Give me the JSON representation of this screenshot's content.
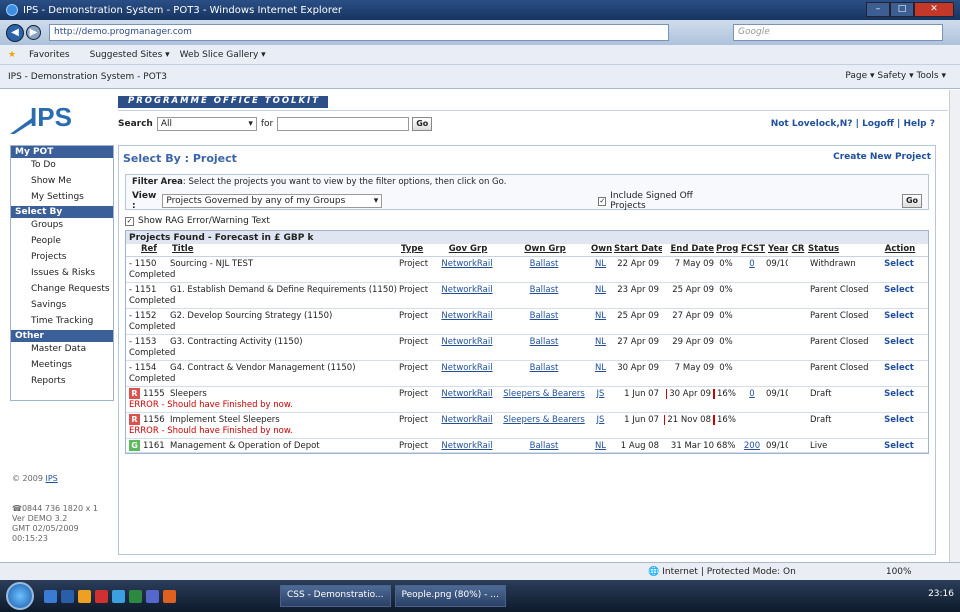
{
  "window": {
    "title": "IPS - Demonstration System - POT3 - Windows Internet Explorer"
  },
  "address": {
    "url": "http://demo.progmanager.com",
    "search_placeholder": "Google"
  },
  "favorites": {
    "label": "Favorites",
    "suggested": "Suggested Sites ▾",
    "webslice": "Web Slice Gallery ▾"
  },
  "tab": {
    "title": "IPS - Demonstration System - POT3",
    "tools": "Page ▾  Safety ▾  Tools ▾"
  },
  "app": {
    "brand": "IPS",
    "banner": "PROGRAMME OFFICE TOOLKIT",
    "search_label": "Search",
    "search_scope": "All",
    "for_label": "for",
    "go": "Go",
    "user_links": "Not Lovelock,N? | Logoff | Help"
  },
  "sidebar": {
    "sections": [
      {
        "title": "My POT",
        "items": [
          "To Do",
          "Show Me",
          "My Settings"
        ]
      },
      {
        "title": "Select By",
        "items": [
          "Groups",
          "People",
          "Projects",
          "Issues & Risks",
          "Change Requests",
          "Savings",
          "Time Tracking"
        ]
      },
      {
        "title": "Other",
        "items": [
          "Master Data",
          "Meetings",
          "Reports"
        ]
      }
    ],
    "copyright": "© 2009",
    "copyright_link": "IPS",
    "phone": "0844 736 1820 x 1",
    "version": "Ver DEMO 3.2",
    "gmt": "GMT 02/05/2009",
    "time": "00:15:23"
  },
  "main": {
    "title": "Select By : Project",
    "create_link": "Create New Project",
    "filter_label": "Filter Area",
    "filter_help": ": Select the projects you want to view by the filter options, then click on Go.",
    "view_label": "View :",
    "view_value": "Projects Governed by any of my Groups",
    "include_label": "Include Signed Off Projects",
    "rag_label": "Show RAG Error/Warning Text",
    "found_title": "Projects Found - Forecast in £ GBP k",
    "columns": [
      "Ref",
      "Title",
      "Type",
      "Gov Grp",
      "Own Grp",
      "Own",
      "Start Date",
      "End Date",
      "Prog",
      "FCST",
      "Year",
      "CR",
      "Status",
      "Action"
    ],
    "rows": [
      {
        "rag": "",
        "ref": "- 1150",
        "title": "Sourcing - NJL TEST",
        "type": "Project",
        "gov": "NetworkRail",
        "own_grp": "Ballast",
        "own": "NL",
        "start": "22 Apr 09",
        "end": "7 May 09",
        "prog": "0%",
        "fcst": "0",
        "year": "09/10",
        "cr": "",
        "status": "Withdrawn",
        "action": "Select",
        "sub": "Completed",
        "sub_err": false,
        "flag": false
      },
      {
        "rag": "",
        "ref": "- 1151",
        "title": "G1. Establish Demand & Define Requirements (1150)",
        "type": "Project",
        "gov": "NetworkRail",
        "own_grp": "Ballast",
        "own": "NL",
        "start": "23 Apr 09",
        "end": "25 Apr 09",
        "prog": "0%",
        "fcst": "",
        "year": "",
        "cr": "",
        "status": "Parent Closed",
        "action": "Select",
        "sub": "Completed",
        "sub_err": false,
        "flag": false
      },
      {
        "rag": "",
        "ref": "- 1152",
        "title": "G2. Develop Sourcing Strategy (1150)",
        "type": "Project",
        "gov": "NetworkRail",
        "own_grp": "Ballast",
        "own": "NL",
        "start": "25 Apr 09",
        "end": "27 Apr 09",
        "prog": "0%",
        "fcst": "",
        "year": "",
        "cr": "",
        "status": "Parent Closed",
        "action": "Select",
        "sub": "Completed",
        "sub_err": false,
        "flag": false
      },
      {
        "rag": "",
        "ref": "- 1153",
        "title": "G3. Contracting Activity (1150)",
        "type": "Project",
        "gov": "NetworkRail",
        "own_grp": "Ballast",
        "own": "NL",
        "start": "27 Apr 09",
        "end": "29 Apr 09",
        "prog": "0%",
        "fcst": "",
        "year": "",
        "cr": "",
        "status": "Parent Closed",
        "action": "Select",
        "sub": "Completed",
        "sub_err": false,
        "flag": false
      },
      {
        "rag": "",
        "ref": "- 1154",
        "title": "G4. Contract & Vendor Management (1150)",
        "type": "Project",
        "gov": "NetworkRail",
        "own_grp": "Ballast",
        "own": "NL",
        "start": "30 Apr 09",
        "end": "7 May 09",
        "prog": "0%",
        "fcst": "",
        "year": "",
        "cr": "",
        "status": "Parent Closed",
        "action": "Select",
        "sub": "Completed",
        "sub_err": false,
        "flag": false
      },
      {
        "rag": "R",
        "ref": "1155",
        "title": "Sleepers",
        "type": "Project",
        "gov": "NetworkRail",
        "own_grp": "Sleepers & Bearers",
        "own": "JS",
        "start": "1 Jun 07",
        "end": "30 Apr 09",
        "prog": "16%",
        "fcst": "0",
        "year": "09/10",
        "cr": "",
        "status": "Draft",
        "action": "Select",
        "sub": "ERROR - Should have Finished by now.",
        "sub_err": true,
        "flag": true
      },
      {
        "rag": "R",
        "ref": "1156",
        "title": "Implement Steel Sleepers",
        "type": "Project",
        "gov": "NetworkRail",
        "own_grp": "Sleepers & Bearers",
        "own": "JS",
        "start": "1 Jun 07",
        "end": "21 Nov 08",
        "prog": "16%",
        "fcst": "",
        "year": "",
        "cr": "",
        "status": "Draft",
        "action": "Select",
        "sub": "ERROR - Should have Finished by now.",
        "sub_err": true,
        "flag": true
      },
      {
        "rag": "G",
        "ref": "1161",
        "title": "Management & Operation of Depot",
        "type": "Project",
        "gov": "NetworkRail",
        "own_grp": "Ballast",
        "own": "NL",
        "start": "1 Aug 08",
        "end": "31 Mar 10",
        "prog": "68%",
        "fcst": "200",
        "year": "09/10",
        "cr": "",
        "status": "Live",
        "action": "Select",
        "sub": "",
        "sub_err": false,
        "flag": false
      }
    ]
  },
  "status": {
    "zone": "Internet | Protected Mode: On",
    "zoom": "100%"
  },
  "taskbar": {
    "buttons": [
      "CSS - Demonstratio...",
      "People.png (80%) - ..."
    ],
    "clock": "23:16"
  }
}
